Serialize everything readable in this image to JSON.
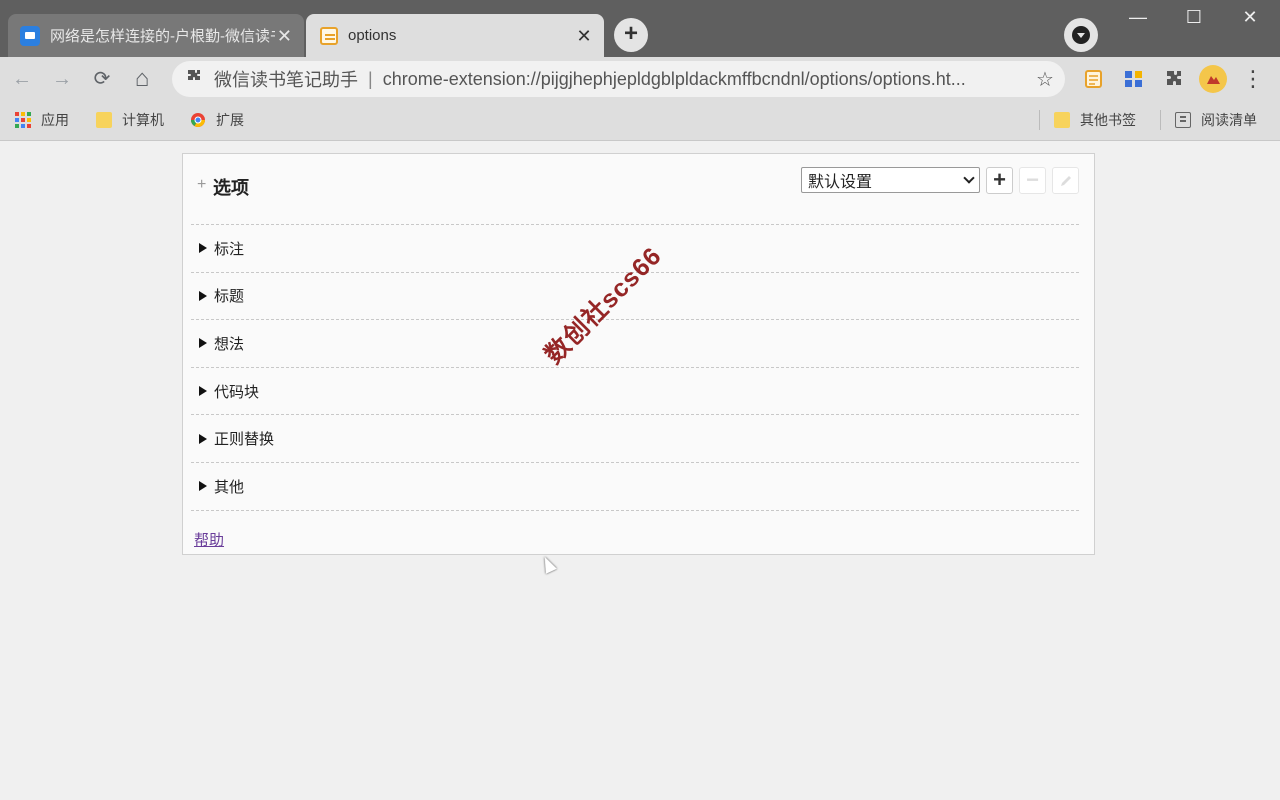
{
  "browser": {
    "tabs": [
      {
        "title": "网络是怎样连接的-户根勤-微信读书",
        "close": "✕",
        "active": false
      },
      {
        "title": "options",
        "close": "✕",
        "active": true
      }
    ],
    "new_tab": "+",
    "window": {
      "minimize": "—",
      "maximize": "☐",
      "close": "✕"
    }
  },
  "toolbar": {
    "back": "←",
    "forward": "→",
    "reload": "⟳",
    "home": "⌂",
    "omnibox": {
      "origin": "微信读书笔记助手",
      "separator": "|",
      "url": "chrome-extension://pijgjhephjepldgblpldackmffbcndnl/options/options.ht...",
      "star": "☆"
    },
    "extensions": [
      "note-extension-icon",
      "apps-extension-icon",
      "puzzle-icon",
      "profile-avatar"
    ],
    "menu": "⋮"
  },
  "bookmarks": {
    "left": [
      {
        "label": "应用",
        "icon": "apps-grid-icon"
      },
      {
        "label": "计算机",
        "icon": "folder-icon"
      },
      {
        "label": "扩展",
        "icon": "chrome-icon"
      }
    ],
    "right": [
      {
        "label": "其他书签",
        "icon": "folder-icon"
      },
      {
        "label": "阅读清单",
        "icon": "reading-list-icon"
      }
    ]
  },
  "options": {
    "title": "选项",
    "profile_selected": "默认设置",
    "sections": [
      "标注",
      "标题",
      "想法",
      "代码块",
      "正则替换",
      "其他"
    ],
    "help_link": "帮助"
  },
  "watermark": "数创社scs66",
  "colors": {
    "tab_strip": "#5f5f5f",
    "toolbar": "#dedede",
    "page_bg": "#f0f0f0",
    "panel_bg": "#fafafa",
    "link": "#6a3d9a",
    "watermark": "#8b1010"
  }
}
